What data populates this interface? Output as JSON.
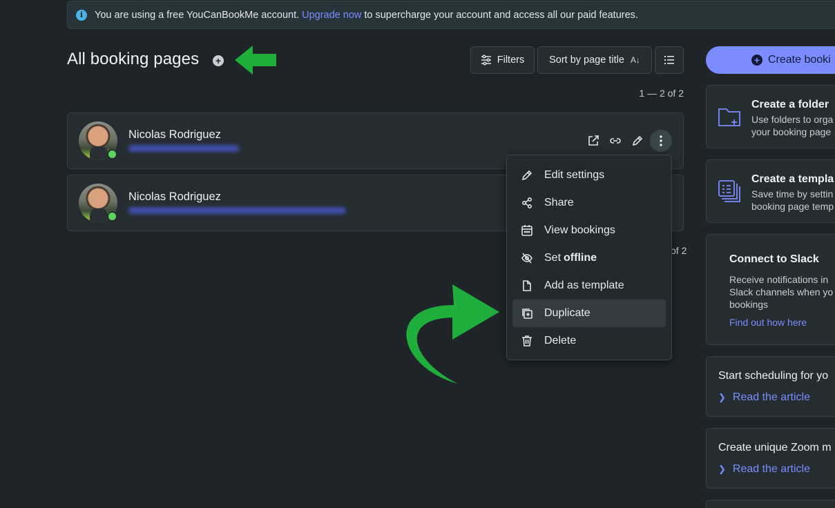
{
  "banner": {
    "prefix": "You are using a free YouCanBookMe account.",
    "link": "Upgrade now",
    "suffix": "to supercharge your account and access all our paid features."
  },
  "header": {
    "title": "All booking pages",
    "filters_label": "Filters",
    "sort_label": "Sort by page title",
    "sort_icon_text": "A↓"
  },
  "pagination": {
    "top": "1 — 2 of 2",
    "bottom": "of 2"
  },
  "cards": [
    {
      "name": "Nicolas Rodriguez",
      "online": true
    },
    {
      "name": "Nicolas Rodriguez",
      "online": true
    }
  ],
  "menu": {
    "items": [
      {
        "label": "Edit settings",
        "icon": "pencil-icon"
      },
      {
        "label": "Share",
        "icon": "share-icon"
      },
      {
        "label": "View bookings",
        "icon": "calendar-icon"
      },
      {
        "label": "Set",
        "bold": "offline",
        "icon": "eye-off-icon"
      },
      {
        "label": "Add as template",
        "icon": "file-icon"
      },
      {
        "label": "Duplicate",
        "icon": "duplicate-icon",
        "highlighted": true
      },
      {
        "label": "Delete",
        "icon": "trash-icon"
      }
    ]
  },
  "sidebar": {
    "create_label": "Create booki",
    "folder": {
      "title": "Create a folder",
      "desc1": "Use folders to orga",
      "desc2": "your booking page"
    },
    "template": {
      "title": "Create a templa",
      "desc1": "Save time by settin",
      "desc2": "booking page temp"
    },
    "slack": {
      "title": "Connect to Slack",
      "desc1": "Receive notifications in",
      "desc2": "Slack channels when yo",
      "desc3": "bookings",
      "link": "Find out how here"
    },
    "article1": {
      "title": "Start scheduling for yo",
      "link": "Read the article"
    },
    "article2": {
      "title": "Create unique Zoom m",
      "link": "Read the article"
    }
  },
  "colors": {
    "background": "#1e2427",
    "accent": "#7b8cff",
    "annotation_arrow": "#1fae3b",
    "online": "#5bd35e"
  }
}
